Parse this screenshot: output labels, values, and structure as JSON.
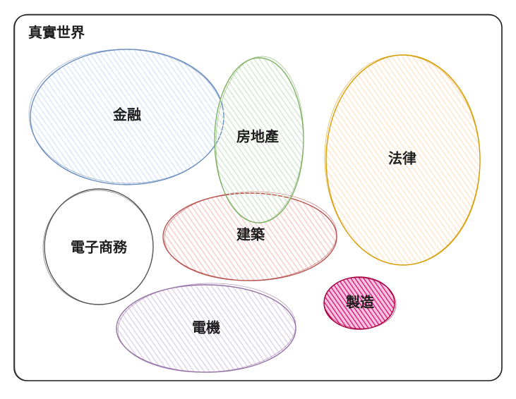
{
  "frame": {
    "title": "真實世界"
  },
  "bubbles": [
    {
      "id": "finance",
      "label": "金融",
      "stroke": "#6c8ebf",
      "fill": "#dae8fc"
    },
    {
      "id": "real-estate",
      "label": "房地產",
      "stroke": "#82b366",
      "fill": "#d5e8d4"
    },
    {
      "id": "law",
      "label": "法律",
      "stroke": "#d79b00",
      "fill": "#ffe6cc"
    },
    {
      "id": "ecommerce",
      "label": "電子商務",
      "stroke": "#555555",
      "fill": "#ffffff"
    },
    {
      "id": "construction",
      "label": "建築",
      "stroke": "#b85450",
      "fill": "#f8cecc"
    },
    {
      "id": "manufacturing",
      "label": "製造",
      "stroke": "#a50040",
      "fill": "#d80073"
    },
    {
      "id": "electrical",
      "label": "電機",
      "stroke": "#9673a6",
      "fill": "#e1d5e7"
    }
  ]
}
